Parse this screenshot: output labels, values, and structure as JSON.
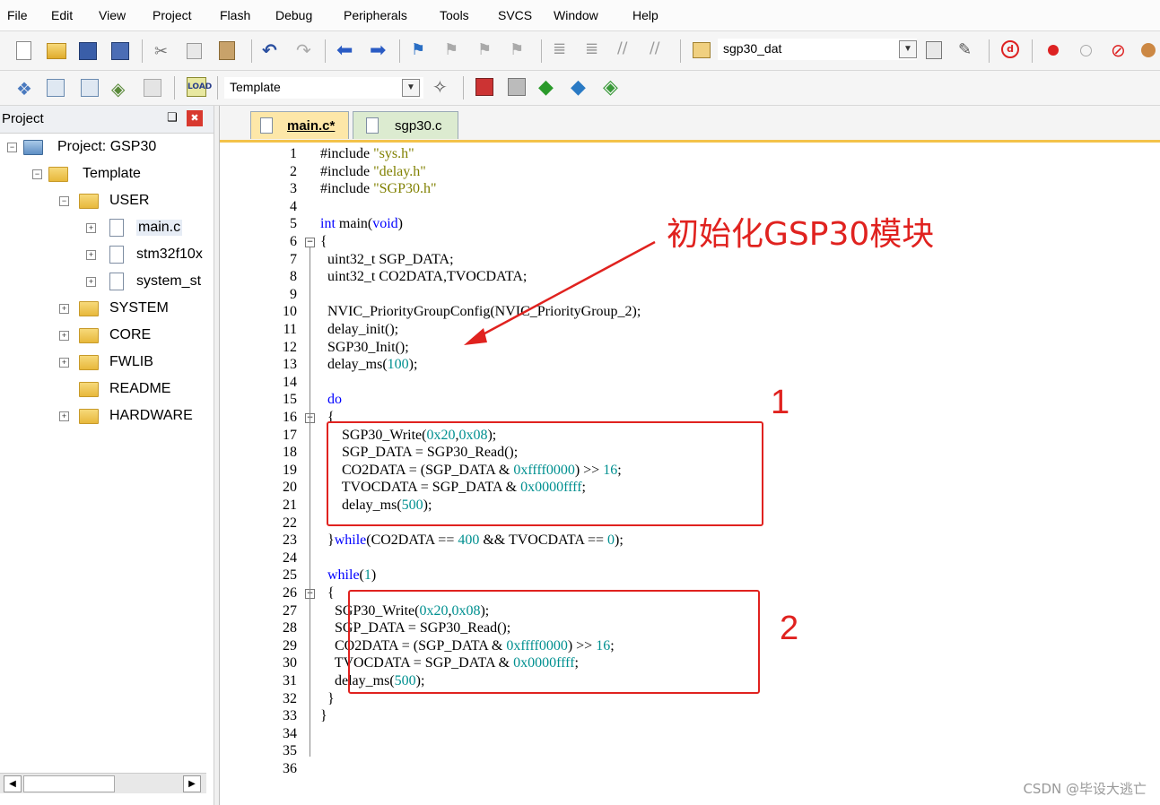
{
  "menu": [
    "File",
    "Edit",
    "View",
    "Project",
    "Flash",
    "Debug",
    "Peripherals",
    "Tools",
    "SVCS",
    "Window",
    "Help"
  ],
  "toolbar1": {
    "target_combo": "sgp30_dat"
  },
  "toolbar2": {
    "target_combo": "Template"
  },
  "project_panel": {
    "title": "Project",
    "pin": "❑",
    "close": "✖",
    "tree": [
      {
        "label": "Project: GSP30",
        "level": 0,
        "type": "project",
        "expander": "−"
      },
      {
        "label": "Template",
        "level": 1,
        "type": "target",
        "expander": "−"
      },
      {
        "label": "USER",
        "level": 2,
        "type": "folder",
        "expander": "−"
      },
      {
        "label": "main.c",
        "level": 3,
        "type": "file",
        "expander": "+"
      },
      {
        "label": "stm32f10x",
        "level": 3,
        "type": "file",
        "expander": "+"
      },
      {
        "label": "system_st",
        "level": 3,
        "type": "file",
        "expander": "+"
      },
      {
        "label": "SYSTEM",
        "level": 2,
        "type": "folder",
        "expander": "+"
      },
      {
        "label": "CORE",
        "level": 2,
        "type": "folder",
        "expander": "+"
      },
      {
        "label": "FWLIB",
        "level": 2,
        "type": "folder",
        "expander": "+"
      },
      {
        "label": "README",
        "level": 2,
        "type": "folder",
        "expander": ""
      },
      {
        "label": "HARDWARE",
        "level": 2,
        "type": "folder",
        "expander": "+"
      }
    ]
  },
  "tabs": [
    {
      "label": "main.c*",
      "active": true
    },
    {
      "label": "sgp30.c",
      "active": false
    }
  ],
  "code_lines": [
    "#include \"sys.h\"",
    "#include \"delay.h\"",
    "#include \"SGP30.h\"",
    "",
    "int main(void)",
    "{",
    "  uint32_t SGP_DATA;",
    "  uint32_t CO2DATA,TVOCDATA;",
    "",
    "  NVIC_PriorityGroupConfig(NVIC_PriorityGroup_2);",
    "  delay_init();",
    "  SGP30_Init();",
    "  delay_ms(100);",
    "",
    "  do",
    "  {",
    "      SGP30_Write(0x20,0x08);",
    "      SGP_DATA = SGP30_Read();",
    "      CO2DATA = (SGP_DATA & 0xffff0000) >> 16;",
    "      TVOCDATA = SGP_DATA & 0x0000ffff;",
    "      delay_ms(500);",
    "",
    "  }while(CO2DATA == 400 && TVOCDATA == 0);",
    "",
    "  while(1)",
    "  {",
    "    SGP30_Write(0x20,0x08);",
    "    SGP_DATA = SGP30_Read();",
    "    CO2DATA = (SGP_DATA & 0xffff0000) >> 16;",
    "    TVOCDATA = SGP_DATA & 0x0000ffff;",
    "    delay_ms(500);",
    "  }",
    "}",
    "",
    "",
    ""
  ],
  "annotations": {
    "init_label": "初始化GSP30模块",
    "box1_label": "1",
    "box2_label": "2"
  },
  "scrollbar": {
    "left": "◀",
    "right": "▶"
  },
  "watermark": "CSDN @毕设大逃亡",
  "colors": {
    "keyword": "#0000ff",
    "string": "#808000",
    "number": "#009090",
    "annotation": "#e0221f"
  }
}
